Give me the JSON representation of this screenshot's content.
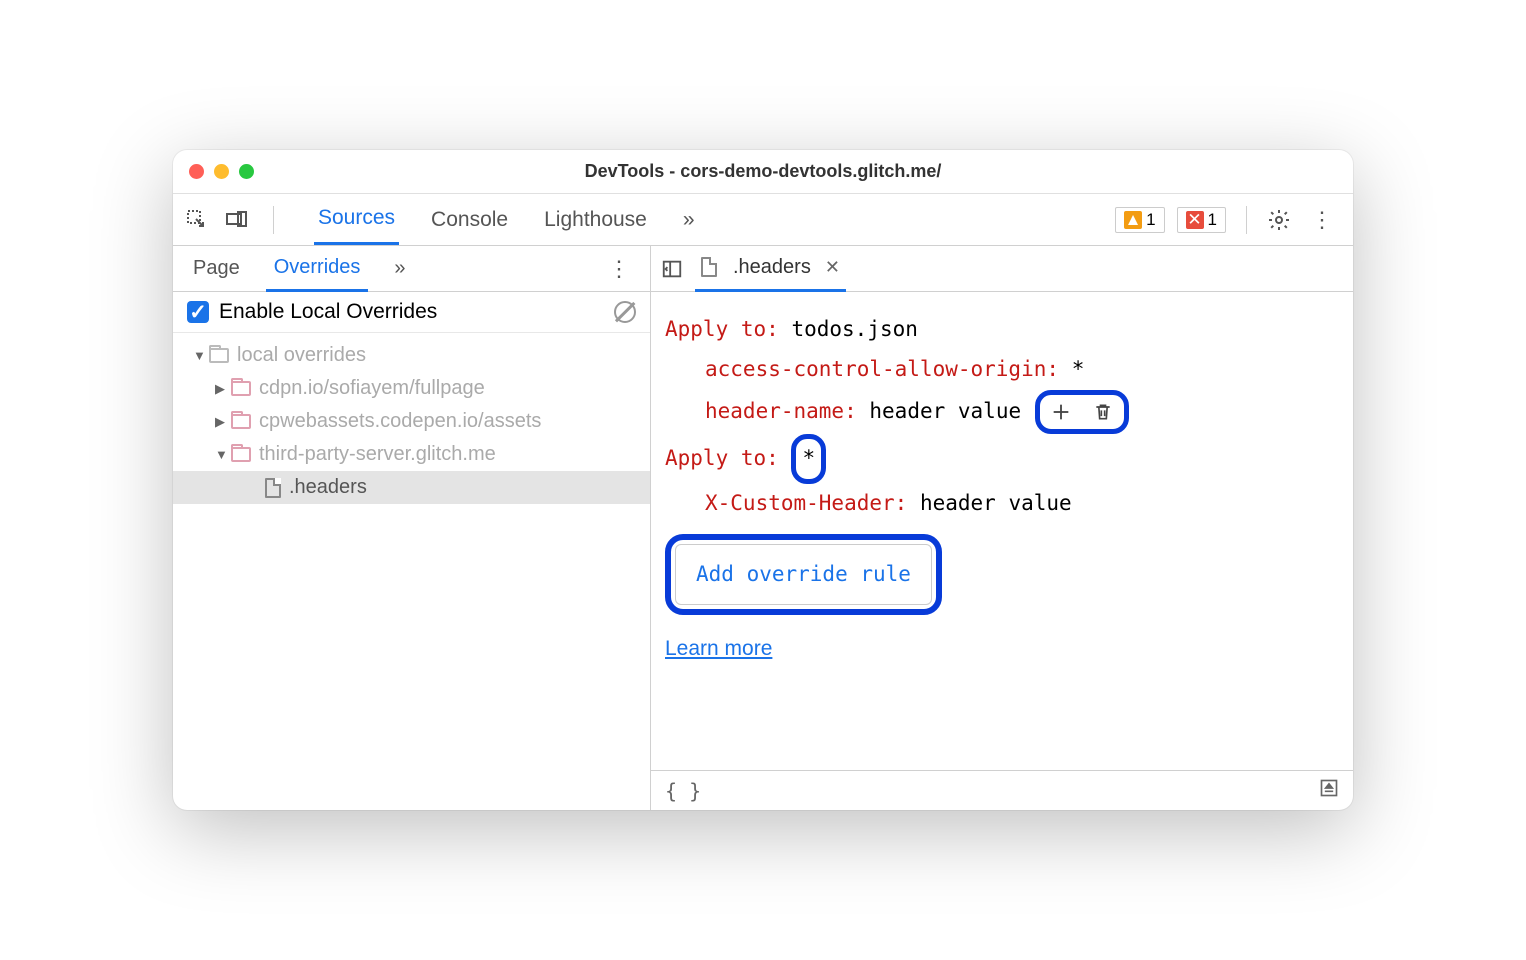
{
  "window": {
    "title": "DevTools - cors-demo-devtools.glitch.me/"
  },
  "toolbar": {
    "tabs": [
      "Sources",
      "Console",
      "Lighthouse"
    ],
    "active_tab": "Sources",
    "overflow": "»",
    "warnings": "1",
    "errors": "1"
  },
  "leftPanel": {
    "subtabs": [
      "Page",
      "Overrides"
    ],
    "active_subtab": "Overrides",
    "overflow": "»",
    "enable_label": "Enable Local Overrides",
    "tree": {
      "root": "local overrides",
      "folders": [
        "cdpn.io/sofiayem/fullpage",
        "cpwebassets.codepen.io/assets",
        "third-party-server.glitch.me"
      ],
      "selected_file": ".headers"
    }
  },
  "editor": {
    "tab_name": ".headers",
    "rules": [
      {
        "apply_label": "Apply to",
        "apply_value": "todos.json",
        "headers": [
          {
            "name": "access-control-allow-origin",
            "value": "*"
          },
          {
            "name": "header-name",
            "value": "header value"
          }
        ]
      },
      {
        "apply_label": "Apply to",
        "apply_value": "*",
        "headers": [
          {
            "name": "X-Custom-Header",
            "value": "header value"
          }
        ]
      }
    ],
    "add_button": "Add override rule",
    "learn_more": "Learn more"
  }
}
